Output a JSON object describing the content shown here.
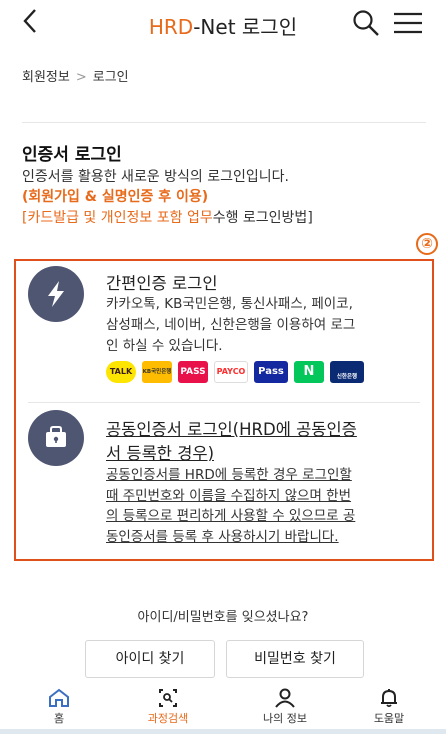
{
  "header": {
    "back_icon": "chevron-left-icon",
    "title_accent": "HRD",
    "title_rest": "-Net 로그인",
    "accent_color": "#e86a1b"
  },
  "breadcrumb": {
    "items": [
      "회원정보",
      "로그인"
    ],
    "separator": ">"
  },
  "cert_section": {
    "title": "인증서 로그인",
    "description": "인증서를 활용한 새로운 방식의 로그인입니다.",
    "note1": "(회원가입 & 실명인증 후 이용)",
    "note2_accent": "[카드발급 및 개인정보 포함 업무",
    "note2_dark": "수행 로그인방법]"
  },
  "badge": "②",
  "simple_auth": {
    "title": "간편인증 로그인",
    "description_lines": [
      "카카오톡, KB국민은행, 통신사패스, 페이코,",
      "삼성패스, 네이버, 신한은행을 이용하여 로그",
      "인 하실 수 있습니다."
    ],
    "logos": [
      {
        "name": "kakao",
        "label": "TALK"
      },
      {
        "name": "kb",
        "label": "KB국민은행"
      },
      {
        "name": "pass",
        "label": "PASS"
      },
      {
        "name": "payco",
        "label": "PAYCO"
      },
      {
        "name": "samsung-pass",
        "label": "Pass"
      },
      {
        "name": "naver",
        "label": "N"
      },
      {
        "name": "shinhan",
        "label": "신한은행"
      }
    ]
  },
  "joint_cert": {
    "title_lines": [
      "공동인증서 로그인(HRD에 공동인증",
      "서 등록한 경우)"
    ],
    "description_lines": [
      "공동인증서를 HRD에 등록한 경우 로그인할",
      "때 주민번호와 이름을 수집하지 않으며 한번",
      "의 등록으로 편리하게 사용할 수 있으므로 공",
      "동인증서를 등록 후 사용하시기 바랍니다."
    ]
  },
  "forgot": {
    "question": "아이디/비밀번호를 잊으셨나요?",
    "find_id": "아이디 찾기",
    "find_pw": "비밀번호 찾기"
  },
  "tabbar": {
    "items": [
      {
        "label": "홈",
        "icon": "home-icon"
      },
      {
        "label": "과정검색",
        "icon": "course-search-icon"
      },
      {
        "label": "나의 정보",
        "icon": "user-icon"
      },
      {
        "label": "도움말",
        "icon": "bell-icon"
      }
    ]
  }
}
